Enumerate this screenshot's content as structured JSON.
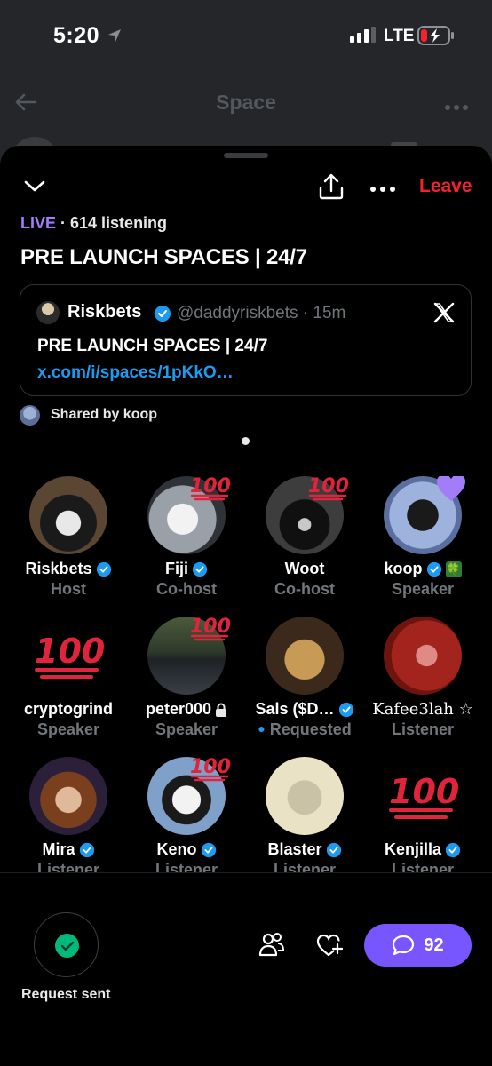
{
  "status_bar": {
    "time": "5:20",
    "network": "LTE"
  },
  "background": {
    "title": "Space"
  },
  "header": {
    "leave_label": "Leave"
  },
  "space": {
    "live_label": "LIVE",
    "listening": " · 614 listening",
    "title": "PRE LAUNCH SPACES | 24/7"
  },
  "tweet": {
    "name": "Riskbets",
    "handle": "@daddyriskbets · 15m",
    "text": "PRE LAUNCH SPACES | 24/7 ",
    "link": "x.com/i/spaces/1pKkO…"
  },
  "shared_by": "Shared by koop",
  "participants": [
    {
      "name": "Riskbets",
      "role": "Host",
      "verified": true
    },
    {
      "name": "Fiji",
      "role": "Co-host",
      "verified": true
    },
    {
      "name": "Woot",
      "role": "Co-host",
      "verified": false
    },
    {
      "name": "koop",
      "role": "Speaker",
      "verified": true,
      "emoji": "🍀"
    },
    {
      "name": "cryptogrind",
      "role": "Speaker",
      "verified": false
    },
    {
      "name": "peter000",
      "role": "Speaker",
      "verified": false,
      "locked": true
    },
    {
      "name": "Sals ($D…",
      "role": "Requested",
      "verified": true
    },
    {
      "name": "Kafee3lah ☆",
      "role": "Listener",
      "verified": false
    },
    {
      "name": "Mira",
      "role": "Listener",
      "verified": true
    },
    {
      "name": "Keno",
      "role": "Listener",
      "verified": true
    },
    {
      "name": "Blaster",
      "role": "Listener",
      "verified": true
    },
    {
      "name": "Kenjilla",
      "role": "Listener",
      "verified": true
    }
  ],
  "badge_text": "100",
  "bottom": {
    "request_label": "Request sent",
    "comment_count": "92"
  },
  "colors": {
    "accent": "#7856ff",
    "live": "#a37cf9",
    "leave": "#f4212e",
    "verified": "#1d9bf0",
    "success": "#00ba7c"
  }
}
